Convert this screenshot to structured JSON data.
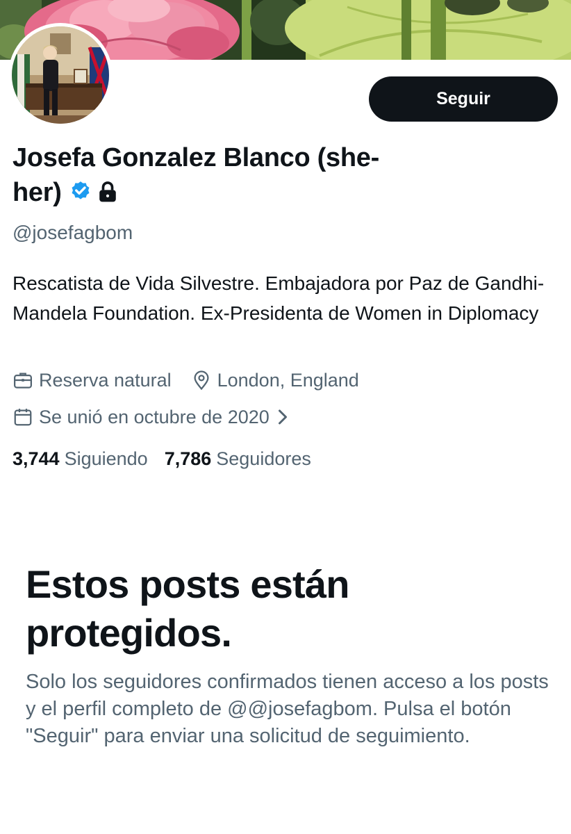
{
  "profile": {
    "follow_label": "Seguir",
    "name": "Josefa Gonzalez Blanco (she-her)",
    "verified_icon": "verified-badge-icon",
    "protected_icon": "lock-icon",
    "handle": "@josefagbom",
    "bio": "Rescatista de Vida Silvestre. Embajadora por Paz de Gandhi-Mandela Foundation. Ex-Presidenta de Women in Diplomacy",
    "profession": "Reserva natural",
    "location": "London, England",
    "joined": "Se unió en octubre de 2020",
    "following_count": "3,744",
    "following_label": "Siguiendo",
    "followers_count": "7,786",
    "followers_label": "Seguidores"
  },
  "protected_notice": {
    "title": "Estos posts están protegidos.",
    "body": "Solo los seguidores confirmados tienen acceso a los posts y el perfil completo de @@josefagbom. Pulsa el botón \"Seguir\" para enviar una solicitud de seguimiento."
  },
  "colors": {
    "text_primary": "#0f1419",
    "text_secondary": "#536471",
    "verified_blue": "#1d9bf0",
    "button_bg": "#0f1419"
  }
}
